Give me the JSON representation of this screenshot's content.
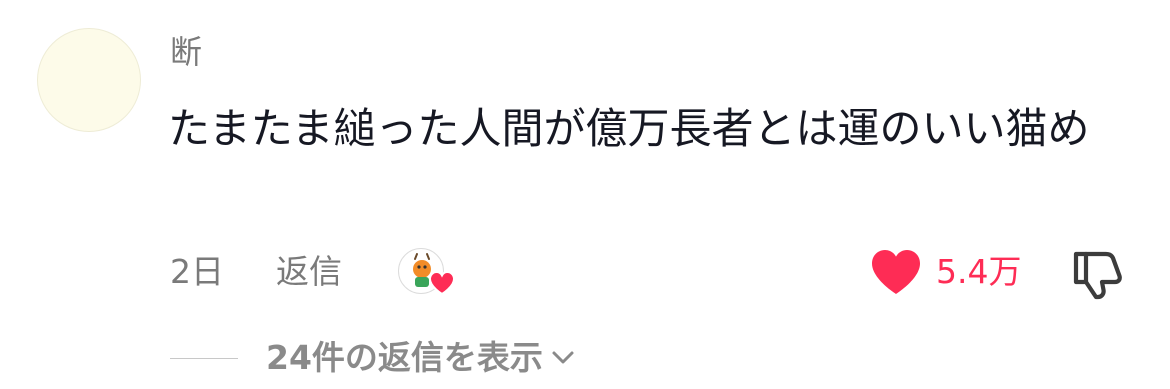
{
  "comment": {
    "username": "断",
    "text": "たまたま縋った人間が億万長者とは運のいい猫め",
    "time": "2日",
    "reply_label": "返信",
    "creator_liked_icon": "creator-liked-heart-icon",
    "like_icon": "heart-icon",
    "like_count": "5.4万",
    "dislike_icon": "thumbs-down-icon",
    "view_replies_label": "24件の返信を表示",
    "view_replies_icon": "chevron-down-icon"
  },
  "colors": {
    "like": "#fe2c55",
    "secondary_text": "#7a7a7a",
    "primary_text": "#161823",
    "avatar_fill": "#fdfbe9"
  }
}
